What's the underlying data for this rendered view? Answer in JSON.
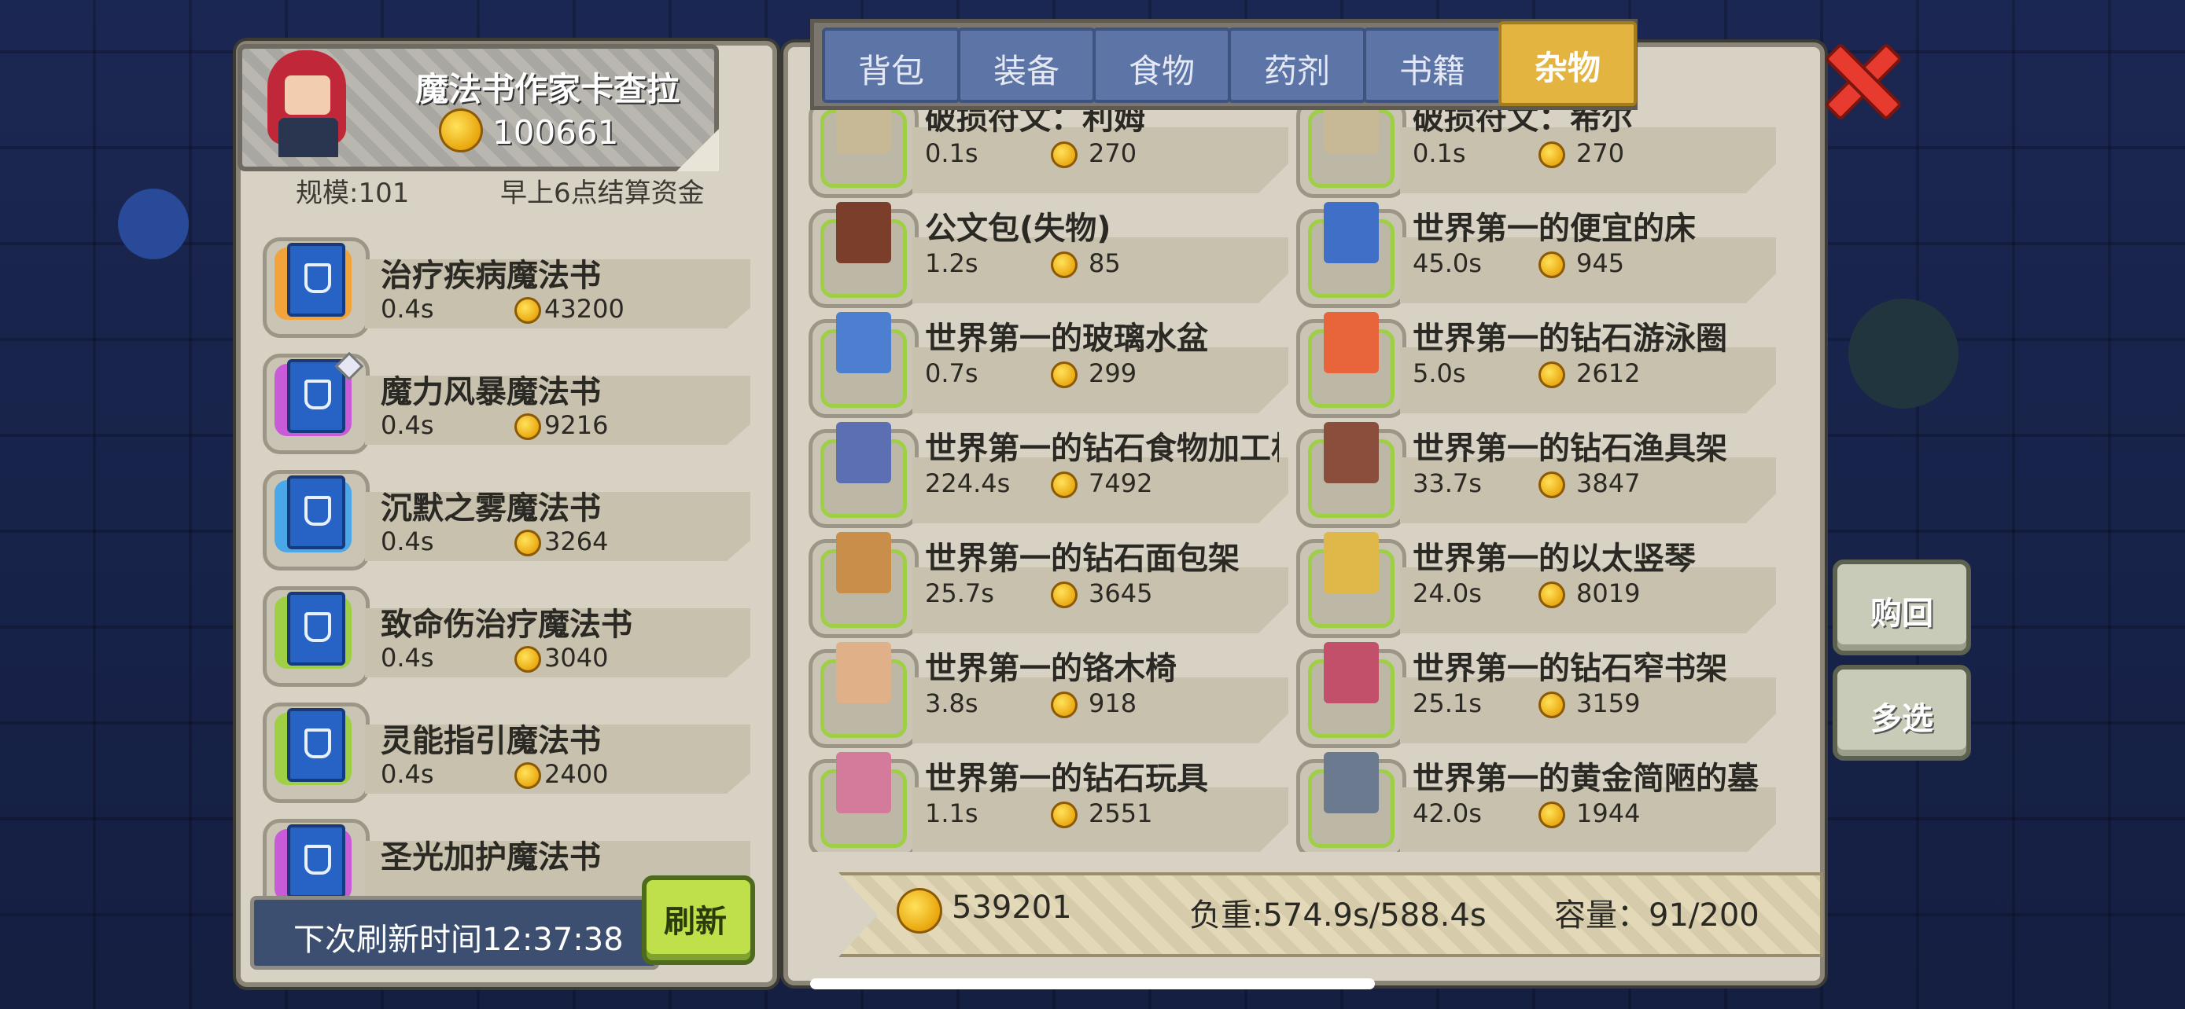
{
  "profile": {
    "title": "魔法书作家卡查拉",
    "money": "100661",
    "scale": "规模:101",
    "settle": "早上6点结算资金"
  },
  "books": [
    {
      "name": "治疗疾病魔法书",
      "time": "0.4s",
      "price": "43200",
      "ring": "#f2a33a",
      "quill": false
    },
    {
      "name": "魔力风暴魔法书",
      "time": "0.4s",
      "price": "9216",
      "ring": "#c95ad8",
      "quill": true
    },
    {
      "name": "沉默之雾魔法书",
      "time": "0.4s",
      "price": "3264",
      "ring": "#4aa7e8",
      "quill": false
    },
    {
      "name": "致命伤治疗魔法书",
      "time": "0.4s",
      "price": "3040",
      "ring": "#9fcf45",
      "quill": false
    },
    {
      "name": "灵能指引魔法书",
      "time": "0.4s",
      "price": "2400",
      "ring": "#9fcf45",
      "quill": false
    },
    {
      "name": "圣光加护魔法书",
      "time": "",
      "price": "",
      "ring": "#c95ad8",
      "quill": false
    }
  ],
  "refresh": {
    "text": "下次刷新时间12:37:38",
    "button": "刷新"
  },
  "tabs": [
    {
      "label": "背包",
      "active": false
    },
    {
      "label": "装备",
      "active": false
    },
    {
      "label": "食物",
      "active": false
    },
    {
      "label": "药剂",
      "active": false
    },
    {
      "label": "书籍",
      "active": false
    },
    {
      "label": "杂物",
      "active": true
    }
  ],
  "items": [
    {
      "name": "破损符文：利姆",
      "time": "0.1s",
      "price": "270",
      "icon": "rune-icon",
      "color": "#c7b995"
    },
    {
      "name": "破损符文：希尔",
      "time": "0.1s",
      "price": "270",
      "icon": "rune-icon",
      "color": "#c7b995"
    },
    {
      "name": "公文包(失物)",
      "time": "1.2s",
      "price": "85",
      "icon": "briefcase-icon",
      "color": "#7a3e2a"
    },
    {
      "name": "世界第一的便宜的床",
      "time": "45.0s",
      "price": "945",
      "icon": "bed-icon",
      "color": "#3f6fc7"
    },
    {
      "name": "世界第一的玻璃水盆",
      "time": "0.7s",
      "price": "299",
      "icon": "basin-icon",
      "color": "#4d7fd0"
    },
    {
      "name": "世界第一的钻石游泳圈",
      "time": "5.0s",
      "price": "2612",
      "icon": "swim-ring-icon",
      "color": "#e8643a"
    },
    {
      "name": "世界第一的钻石食物加工机",
      "time": "224.4s",
      "price": "7492",
      "icon": "food-processor-icon",
      "color": "#5d6fb3"
    },
    {
      "name": "世界第一的钻石渔具架",
      "time": "33.7s",
      "price": "3847",
      "icon": "fishing-rack-icon",
      "color": "#8a4f3c"
    },
    {
      "name": "世界第一的钻石面包架",
      "time": "25.7s",
      "price": "3645",
      "icon": "bread-rack-icon",
      "color": "#c98e4a"
    },
    {
      "name": "世界第一的以太竖琴",
      "time": "24.0s",
      "price": "8019",
      "icon": "harp-icon",
      "color": "#e0b84a"
    },
    {
      "name": "世界第一的铬木椅",
      "time": "3.8s",
      "price": "918",
      "icon": "chair-icon",
      "color": "#e0b088"
    },
    {
      "name": "世界第一的钻石窄书架",
      "time": "25.1s",
      "price": "3159",
      "icon": "bookshelf-icon",
      "color": "#c2506a"
    },
    {
      "name": "世界第一的钻石玩具",
      "time": "1.1s",
      "price": "2551",
      "icon": "teddy-bear-icon",
      "color": "#d47a9a"
    },
    {
      "name": "世界第一的黄金简陋的墓",
      "time": "42.0s",
      "price": "1944",
      "icon": "tombstone-icon",
      "color": "#6b7a8f"
    }
  ],
  "status": {
    "money": "539201",
    "load": "负重:574.9s/588.4s",
    "capacity": "容量：91/200"
  },
  "side_buttons": {
    "buyback": "购回",
    "multiselect": "多选"
  }
}
